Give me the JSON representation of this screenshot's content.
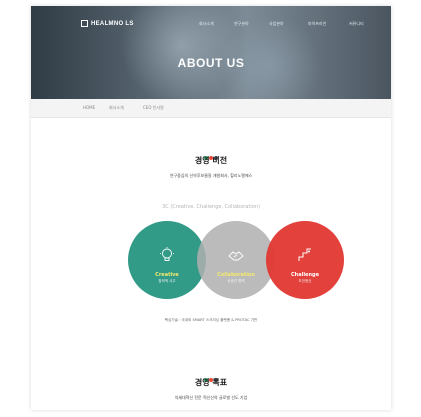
{
  "brand": {
    "logo_text": "HEALMNO LS"
  },
  "nav": {
    "items": [
      "회사소개",
      "연구분야",
      "사업분야",
      "파이프라인",
      "커뮤니티"
    ]
  },
  "hero": {
    "title": "ABOUT US"
  },
  "breadcrumb": [
    "HOME",
    "회사소개",
    "CEO 인사말"
  ],
  "vision": {
    "title": "경영 비전",
    "subtitle": "연구중심의 신약후보물질 개발회사, 힐리노엘에스",
    "tagline": "3C (Creative, Challenge, Collaboration)",
    "circles": [
      {
        "name": "Creative",
        "desc": "창의적 사고",
        "color": "#26967f",
        "icon": "lightbulb-icon"
      },
      {
        "name": "Collaboration",
        "desc": "상호간 협력",
        "color": "#afafaf",
        "icon": "handshake-icon"
      },
      {
        "name": "Challenge",
        "desc": "도전정신",
        "color": "#e13732",
        "icon": "climb-icon"
      }
    ],
    "note": "핵심기술 : 국내외 SMART 스크리닝 플랫폼 & PROTAC 기반"
  },
  "goal": {
    "title": "경영 목표",
    "subtitle": "차세대혁신 전문 혁신신약 글로벌 선도 기업"
  },
  "accent_dots": [
    "#2bb673",
    "#e84b3c",
    "#3d4a57"
  ]
}
